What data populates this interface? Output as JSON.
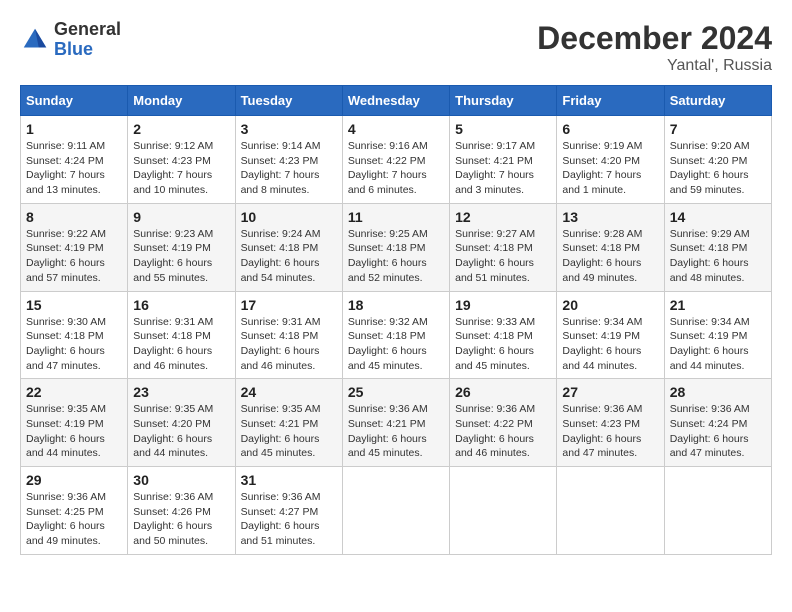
{
  "header": {
    "logo_line1": "General",
    "logo_line2": "Blue",
    "month_title": "December 2024",
    "location": "Yantal', Russia"
  },
  "weekdays": [
    "Sunday",
    "Monday",
    "Tuesday",
    "Wednesday",
    "Thursday",
    "Friday",
    "Saturday"
  ],
  "weeks": [
    [
      {
        "day": "1",
        "sunrise": "9:11 AM",
        "sunset": "4:24 PM",
        "daylight": "7 hours and 13 minutes."
      },
      {
        "day": "2",
        "sunrise": "9:12 AM",
        "sunset": "4:23 PM",
        "daylight": "7 hours and 10 minutes."
      },
      {
        "day": "3",
        "sunrise": "9:14 AM",
        "sunset": "4:23 PM",
        "daylight": "7 hours and 8 minutes."
      },
      {
        "day": "4",
        "sunrise": "9:16 AM",
        "sunset": "4:22 PM",
        "daylight": "7 hours and 6 minutes."
      },
      {
        "day": "5",
        "sunrise": "9:17 AM",
        "sunset": "4:21 PM",
        "daylight": "7 hours and 3 minutes."
      },
      {
        "day": "6",
        "sunrise": "9:19 AM",
        "sunset": "4:20 PM",
        "daylight": "7 hours and 1 minute."
      },
      {
        "day": "7",
        "sunrise": "9:20 AM",
        "sunset": "4:20 PM",
        "daylight": "6 hours and 59 minutes."
      }
    ],
    [
      {
        "day": "8",
        "sunrise": "9:22 AM",
        "sunset": "4:19 PM",
        "daylight": "6 hours and 57 minutes."
      },
      {
        "day": "9",
        "sunrise": "9:23 AM",
        "sunset": "4:19 PM",
        "daylight": "6 hours and 55 minutes."
      },
      {
        "day": "10",
        "sunrise": "9:24 AM",
        "sunset": "4:18 PM",
        "daylight": "6 hours and 54 minutes."
      },
      {
        "day": "11",
        "sunrise": "9:25 AM",
        "sunset": "4:18 PM",
        "daylight": "6 hours and 52 minutes."
      },
      {
        "day": "12",
        "sunrise": "9:27 AM",
        "sunset": "4:18 PM",
        "daylight": "6 hours and 51 minutes."
      },
      {
        "day": "13",
        "sunrise": "9:28 AM",
        "sunset": "4:18 PM",
        "daylight": "6 hours and 49 minutes."
      },
      {
        "day": "14",
        "sunrise": "9:29 AM",
        "sunset": "4:18 PM",
        "daylight": "6 hours and 48 minutes."
      }
    ],
    [
      {
        "day": "15",
        "sunrise": "9:30 AM",
        "sunset": "4:18 PM",
        "daylight": "6 hours and 47 minutes."
      },
      {
        "day": "16",
        "sunrise": "9:31 AM",
        "sunset": "4:18 PM",
        "daylight": "6 hours and 46 minutes."
      },
      {
        "day": "17",
        "sunrise": "9:31 AM",
        "sunset": "4:18 PM",
        "daylight": "6 hours and 46 minutes."
      },
      {
        "day": "18",
        "sunrise": "9:32 AM",
        "sunset": "4:18 PM",
        "daylight": "6 hours and 45 minutes."
      },
      {
        "day": "19",
        "sunrise": "9:33 AM",
        "sunset": "4:18 PM",
        "daylight": "6 hours and 45 minutes."
      },
      {
        "day": "20",
        "sunrise": "9:34 AM",
        "sunset": "4:19 PM",
        "daylight": "6 hours and 44 minutes."
      },
      {
        "day": "21",
        "sunrise": "9:34 AM",
        "sunset": "4:19 PM",
        "daylight": "6 hours and 44 minutes."
      }
    ],
    [
      {
        "day": "22",
        "sunrise": "9:35 AM",
        "sunset": "4:19 PM",
        "daylight": "6 hours and 44 minutes."
      },
      {
        "day": "23",
        "sunrise": "9:35 AM",
        "sunset": "4:20 PM",
        "daylight": "6 hours and 44 minutes."
      },
      {
        "day": "24",
        "sunrise": "9:35 AM",
        "sunset": "4:21 PM",
        "daylight": "6 hours and 45 minutes."
      },
      {
        "day": "25",
        "sunrise": "9:36 AM",
        "sunset": "4:21 PM",
        "daylight": "6 hours and 45 minutes."
      },
      {
        "day": "26",
        "sunrise": "9:36 AM",
        "sunset": "4:22 PM",
        "daylight": "6 hours and 46 minutes."
      },
      {
        "day": "27",
        "sunrise": "9:36 AM",
        "sunset": "4:23 PM",
        "daylight": "6 hours and 47 minutes."
      },
      {
        "day": "28",
        "sunrise": "9:36 AM",
        "sunset": "4:24 PM",
        "daylight": "6 hours and 47 minutes."
      }
    ],
    [
      {
        "day": "29",
        "sunrise": "9:36 AM",
        "sunset": "4:25 PM",
        "daylight": "6 hours and 49 minutes."
      },
      {
        "day": "30",
        "sunrise": "9:36 AM",
        "sunset": "4:26 PM",
        "daylight": "6 hours and 50 minutes."
      },
      {
        "day": "31",
        "sunrise": "9:36 AM",
        "sunset": "4:27 PM",
        "daylight": "6 hours and 51 minutes."
      },
      null,
      null,
      null,
      null
    ]
  ]
}
